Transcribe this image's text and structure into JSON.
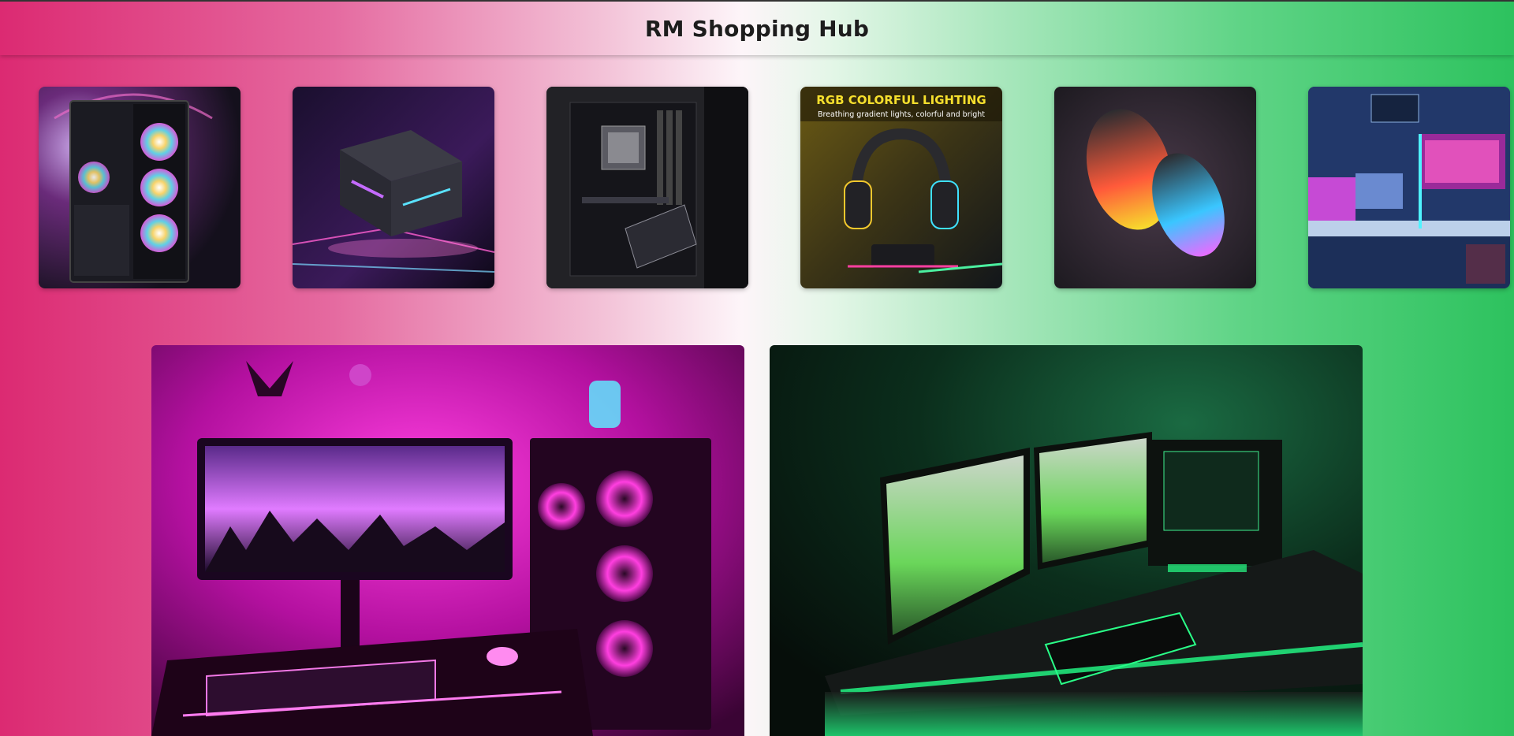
{
  "header": {
    "title": "RM Shopping Hub"
  },
  "thumbnails": [
    {
      "subject": "pc-case-rgb-fans"
    },
    {
      "subject": "power-supply-unit"
    },
    {
      "subject": "motherboard"
    },
    {
      "subject": "rgb-gaming-headset",
      "caption": "RGB COLORFUL LIGHTING",
      "subcaption": "Breathing gradient lights, colorful and bright"
    },
    {
      "subject": "rgb-gaming-mice"
    },
    {
      "subject": "blue-gaming-room"
    }
  ],
  "heroes": [
    {
      "subject": "pink-gaming-setup"
    },
    {
      "subject": "green-gaming-setup"
    }
  ],
  "colors": {
    "gradient_left": "#dc2a72",
    "gradient_center": "#fdf5f9",
    "gradient_right": "#2dc25e",
    "pink_glow": "#e21bd6",
    "green_glow": "#19d96a"
  }
}
